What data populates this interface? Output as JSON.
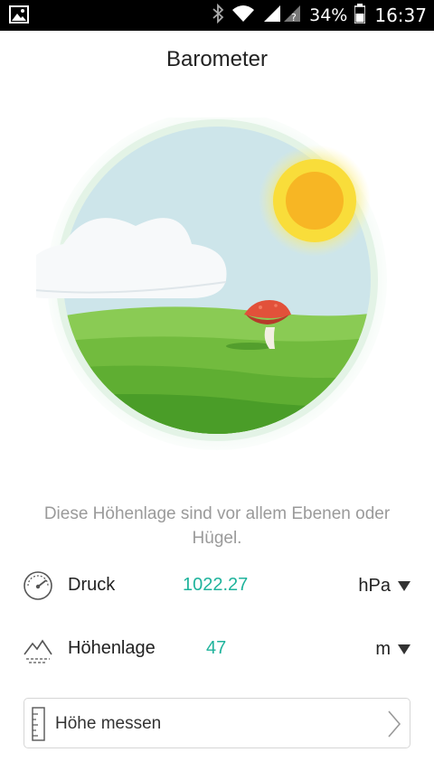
{
  "status_bar": {
    "battery_percent": "34%",
    "time": "16:37",
    "icons": [
      "image-icon",
      "bluetooth-icon",
      "wifi-icon",
      "signal-icon",
      "battery-icon"
    ]
  },
  "header": {
    "title": "Barometer"
  },
  "illustration": {
    "icons": [
      "sun-icon",
      "cloud-icon",
      "mushroom-icon"
    ],
    "colors": {
      "sky": "#cfe6ec",
      "sun": "#fcc62b",
      "grass": "#5fb032",
      "mushroom": "#e2513a"
    }
  },
  "description": "Diese Höhenlage sind vor allem Ebenen oder Hügel.",
  "pressure": {
    "label": "Druck",
    "value": "1022.27",
    "unit": "hPa",
    "icon": "gauge-icon"
  },
  "altitude": {
    "label": "Höhenlage",
    "value": "47",
    "unit": "m",
    "icon": "mountain-icon"
  },
  "measure_button": {
    "label": "Höhe messen",
    "icon": "ruler-icon",
    "chevron": "chevron-right-icon"
  },
  "colors": {
    "accent": "#1fb39c",
    "muted_text": "#9a9a9a"
  }
}
